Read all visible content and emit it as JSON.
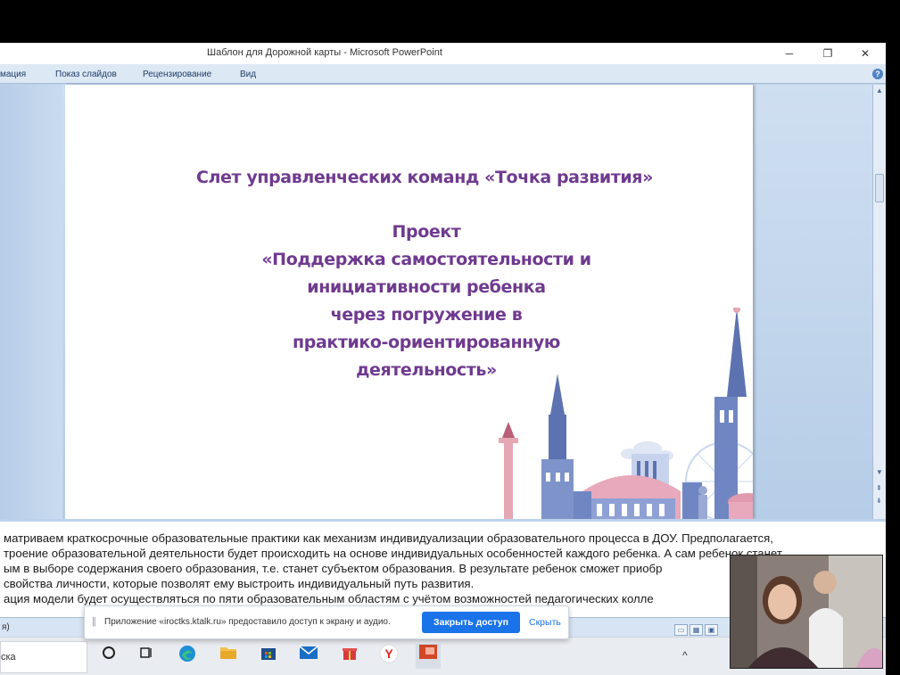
{
  "window": {
    "title": "Шаблон для Дорожной карты - Microsoft PowerPoint",
    "minimize": "─",
    "restore": "❐",
    "close": "✕"
  },
  "ribbon": {
    "tabs": [
      "мация",
      "Показ слайдов",
      "Рецензирование",
      "Вид"
    ],
    "help": "?"
  },
  "slide": {
    "heading": "Слет управленческих команд «Точка развития»",
    "body_lines": [
      "Проект",
      "«Поддержка самостоятельности и",
      "инициативности ребенка",
      "через погружение в",
      "практико-ориентированную",
      "деятельность»"
    ]
  },
  "notes": {
    "lines": [
      "матриваем краткосрочные образовательные практики как механизм индивидуализации образовательного процесса в ДОУ. Предполагается,",
      "троение образовательной деятельности будет происходить на основе индивидуальных особенностей каждого ребенка. А сам ребенок станет",
      "ым в выборе содержания своего образования, т.е. станет субъектом образования.  В результате ребенок сможет приобр",
      " свойства личности, которые позволят ему выстроить индивидуальный путь развития.",
      "ация модели будет осуществляться   по пяти образовательным областям с учётом возможностей педагогических колле"
    ]
  },
  "statusbar": {
    "left_text": "я)"
  },
  "share_banner": {
    "handle": "||",
    "text": "Приложение «iroctks.ktalk.ru» предоставило доступ к экрану и аудио.",
    "stop_button": "Закрыть доступ",
    "hide_button": "Скрыть"
  },
  "taskbar": {
    "search_text": "ска",
    "icons": [
      "task-view-icon",
      "edge-icon",
      "file-explorer-icon",
      "store-icon",
      "mail-icon",
      "gift-icon",
      "yandex-browser-icon",
      "powerpoint-icon"
    ],
    "tray_text": "^"
  },
  "webcam": {
    "label": ""
  }
}
